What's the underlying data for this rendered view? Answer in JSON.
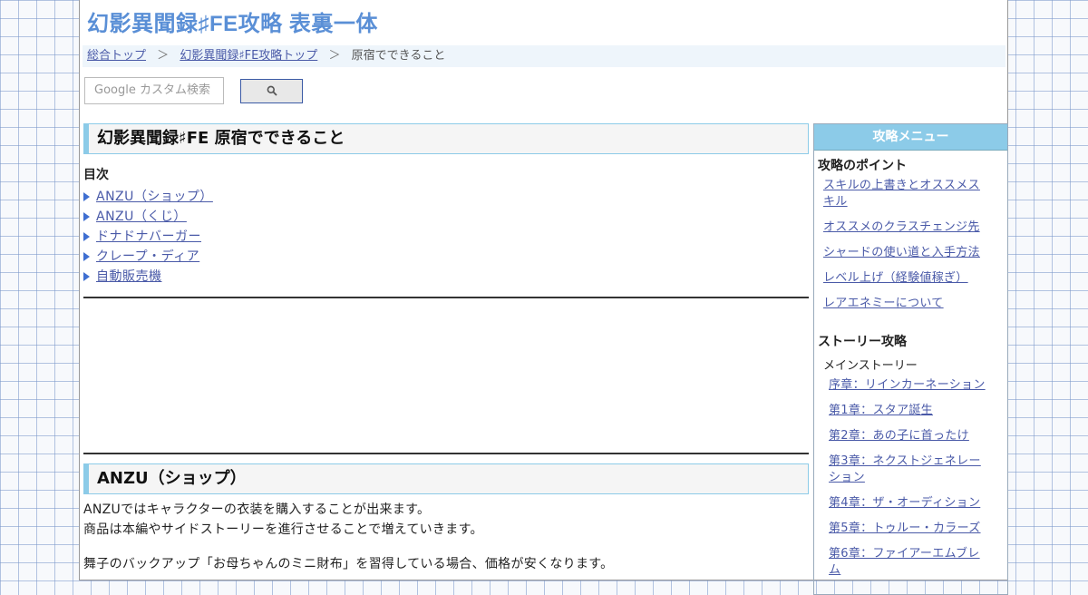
{
  "site": {
    "title": "幻影異聞録♯FE攻略 表裏一体"
  },
  "breadcrumb": {
    "items": [
      "総合トップ",
      "幻影異聞録♯FE攻略トップ"
    ],
    "current": "原宿でできること",
    "separator": "＞"
  },
  "search": {
    "placeholder": "Google カスタム検索",
    "button_icon": "search-icon"
  },
  "main": {
    "title": "幻影異聞録♯FE 原宿でできること",
    "toc_title": "目次",
    "toc": [
      "ANZU（ショップ）",
      "ANZU（くじ）",
      "ドナドナバーガー",
      "クレープ・ディア",
      "自動販売機"
    ],
    "section1": {
      "title": "ANZU（ショップ）",
      "lines": [
        "ANZUではキャラクターの衣装を購入することが出来ます。",
        "商品は本編やサイドストーリーを進行させることで増えていきます。"
      ],
      "line3": "舞子のバックアップ「お母ちゃんのミニ財布」を習得している場合、価格が安くなります。"
    }
  },
  "sidebar": {
    "menu_title": "攻略メニュー",
    "points_title": "攻略のポイント",
    "points": [
      "スキルの上書きとオススメスキル",
      "オススメのクラスチェンジ先",
      "シャードの使い道と入手方法",
      "レベル上げ（経験値稼ぎ）",
      "レアエネミーについて"
    ],
    "story_title": "ストーリー攻略",
    "main_story_label": "メインストーリー",
    "chapters": [
      "序章：リインカーネーション",
      "第1章：スタア誕生",
      "第2章：あの子に首ったけ",
      "第3章：ネクストジェネレーション",
      "第4章：ザ・オーディション",
      "第5章：トゥルー・カラーズ",
      "第6章：ファイアーエムブレム"
    ]
  },
  "colors": {
    "accent": "#8ccbe8",
    "title": "#5a8fd6",
    "link": "#4a5aa8",
    "bullet": "#3f6fd1"
  }
}
